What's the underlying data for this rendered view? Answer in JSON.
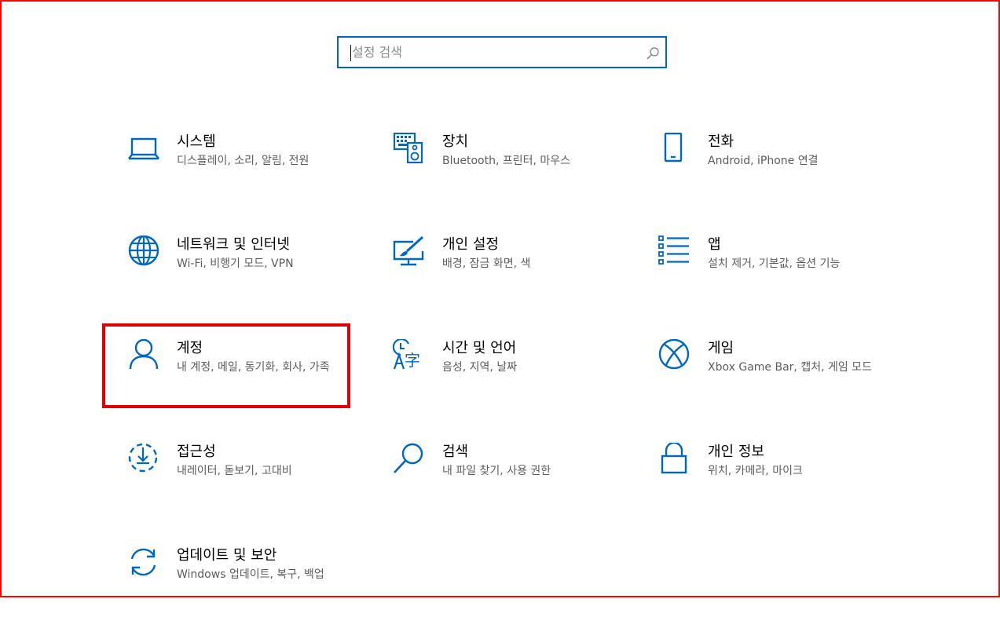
{
  "search": {
    "placeholder": "설정 검색",
    "icon": "search-icon"
  },
  "accent_color": "#0067c0",
  "highlight_color": "#e00000",
  "tiles": [
    {
      "id": "system",
      "icon": "laptop-icon",
      "title": "시스템",
      "desc": "디스플레이, 소리, 알림, 전원"
    },
    {
      "id": "devices",
      "icon": "keyboard-speaker-icon",
      "title": "장치",
      "desc": "Bluetooth, 프린터, 마우스"
    },
    {
      "id": "phone",
      "icon": "phone-icon",
      "title": "전화",
      "desc": "Android, iPhone 연결"
    },
    {
      "id": "network",
      "icon": "globe-icon",
      "title": "네트워크 및 인터넷",
      "desc": "Wi-Fi, 비행기 모드, VPN"
    },
    {
      "id": "personalization",
      "icon": "paint-monitor-icon",
      "title": "개인 설정",
      "desc": "배경, 잠금 화면, 색"
    },
    {
      "id": "apps",
      "icon": "apps-list-icon",
      "title": "앱",
      "desc": "설치 제거, 기본값, 옵션 기능"
    },
    {
      "id": "accounts",
      "icon": "person-icon",
      "title": "계정",
      "desc": "내 계정, 메일, 동기화, 회사, 가족"
    },
    {
      "id": "time-language",
      "icon": "time-language-icon",
      "title": "시간 및 언어",
      "desc": "음성, 지역, 날짜"
    },
    {
      "id": "gaming",
      "icon": "xbox-icon",
      "title": "게임",
      "desc": "Xbox Game Bar, 캡처, 게임 모드"
    },
    {
      "id": "ease-of-access",
      "icon": "ease-of-access-icon",
      "title": "접근성",
      "desc": "내레이터, 돋보기, 고대비"
    },
    {
      "id": "search",
      "icon": "magnifier-icon",
      "title": "검색",
      "desc": "내 파일 찾기, 사용 권한"
    },
    {
      "id": "privacy",
      "icon": "lock-icon",
      "title": "개인 정보",
      "desc": "위치, 카메라, 마이크"
    },
    {
      "id": "update-security",
      "icon": "sync-icon",
      "title": "업데이트 및 보안",
      "desc": "Windows 업데이트, 복구, 백업"
    }
  ]
}
